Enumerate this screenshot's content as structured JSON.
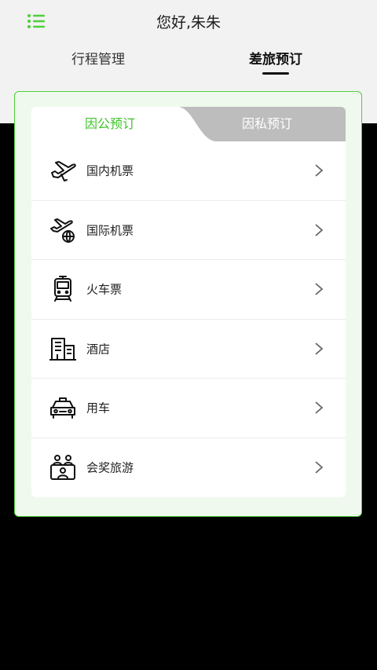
{
  "header": {
    "greeting": "您好,朱朱",
    "menu_icon": "list-menu-icon",
    "accent_color": "#4cd137",
    "tabs": [
      {
        "label": "行程管理",
        "active": false
      },
      {
        "label": "差旅预订",
        "active": true
      }
    ]
  },
  "booking": {
    "tabs": [
      {
        "label": "因公预订",
        "active": true
      },
      {
        "label": "因私预订",
        "active": false
      }
    ],
    "items": [
      {
        "label": "国内机票",
        "icon": "airplane-icon"
      },
      {
        "label": "国际机票",
        "icon": "international-flight-icon"
      },
      {
        "label": "火车票",
        "icon": "train-icon"
      },
      {
        "label": "酒店",
        "icon": "hotel-building-icon"
      },
      {
        "label": "用车",
        "icon": "car-icon"
      },
      {
        "label": "会奖旅游",
        "icon": "group-tour-icon"
      }
    ]
  }
}
